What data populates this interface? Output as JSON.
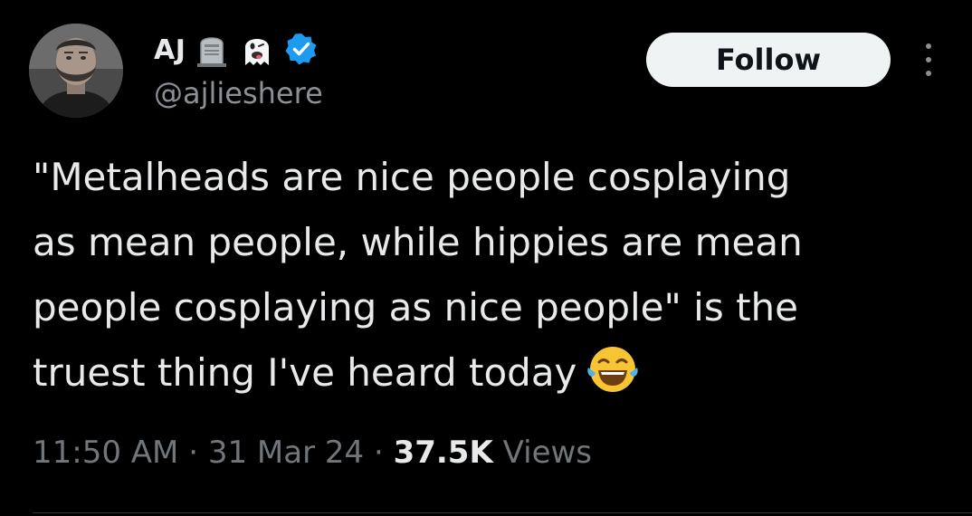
{
  "author": {
    "display_name": "AJ",
    "handle": "@ajlieshere",
    "badge_icons": [
      "headstone-icon",
      "ghost-icon",
      "verified-badge-icon"
    ]
  },
  "actions": {
    "follow_label": "Follow",
    "more_icon": "more-vertical-icon"
  },
  "tweet": {
    "text_lines": [
      "\"Metalheads are nice people cosplaying",
      "as mean people, while hippies are mean",
      "people cosplaying as nice people\" is the",
      "truest thing I've heard today"
    ],
    "trailing_emoji": "laughing-tears-emoji"
  },
  "meta": {
    "time": "11:50 AM",
    "separator": "·",
    "date": "31 Mar 24",
    "views_count": "37.5K",
    "views_label": "Views"
  },
  "colors": {
    "background": "#000000",
    "text_primary": "#e7e9ea",
    "text_secondary": "#71767b",
    "verified": "#1d9bf0",
    "follow_bg": "#eff3f4"
  }
}
